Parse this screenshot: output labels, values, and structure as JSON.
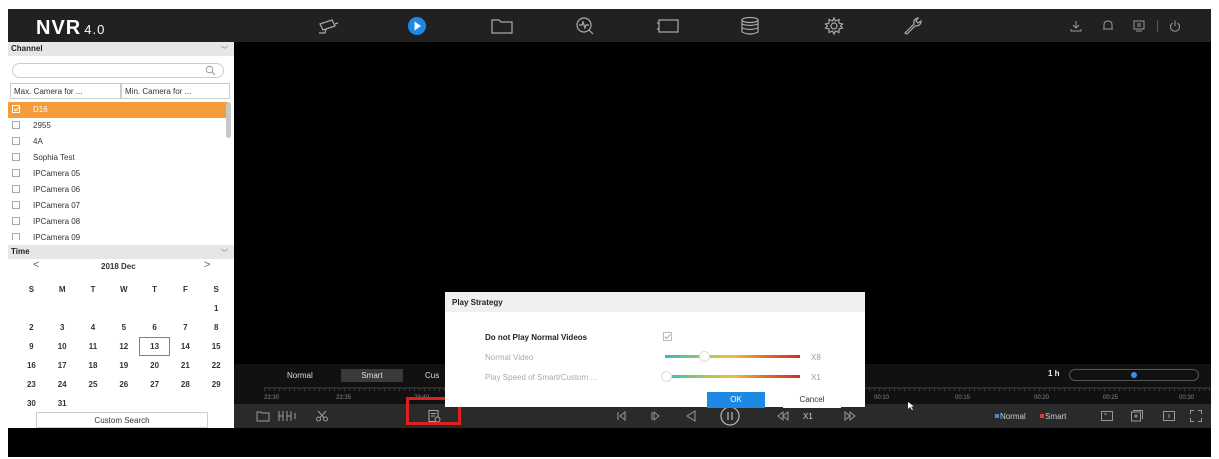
{
  "app": {
    "logo": "NVR",
    "version": "4.0"
  },
  "channel": {
    "title": "Channel",
    "search_placeholder": "",
    "max_camera_label": "Max. Camera for ...",
    "min_camera_label": "Min. Camera for ...",
    "items": [
      {
        "label": "D16",
        "selected": true
      },
      {
        "label": "2955",
        "selected": false
      },
      {
        "label": "4A",
        "selected": false
      },
      {
        "label": "Sophia Test",
        "selected": false
      },
      {
        "label": "IPCamera 05",
        "selected": false
      },
      {
        "label": "IPCamera 06",
        "selected": false
      },
      {
        "label": "IPCamera 07",
        "selected": false
      },
      {
        "label": "IPCamera 08",
        "selected": false
      },
      {
        "label": "IPCamera 09",
        "selected": false
      }
    ]
  },
  "time": {
    "title": "Time",
    "month_label": "2018 Dec",
    "weekdays": [
      "S",
      "M",
      "T",
      "W",
      "T",
      "F",
      "S"
    ],
    "weeks": [
      [
        "",
        "",
        "",
        "",
        "",
        "",
        "1"
      ],
      [
        "2",
        "3",
        "4",
        "5",
        "6",
        "7",
        "8"
      ],
      [
        "9",
        "10",
        "11",
        "12",
        "13",
        "14",
        "15"
      ],
      [
        "16",
        "17",
        "18",
        "19",
        "20",
        "21",
        "22"
      ],
      [
        "23",
        "24",
        "25",
        "26",
        "27",
        "28",
        "29"
      ],
      [
        "30",
        "31",
        "",
        "",
        "",
        "",
        ""
      ]
    ],
    "today": "13",
    "custom_search_label": "Custom Search"
  },
  "timeline": {
    "tabs": [
      "Normal",
      "Smart",
      "Cus"
    ],
    "active_tab": "Smart",
    "scale_label": "1 h",
    "scale_value": 0.5,
    "ticks": [
      "23:30",
      "23:35",
      "23:40",
      "00:10",
      "00:15",
      "00:20",
      "00:25",
      "00:30"
    ],
    "speed_label": "X1",
    "legend": {
      "normal": "Normal",
      "smart": "Smart",
      "normal_color": "#3a8ee6",
      "smart_color": "#e53935"
    }
  },
  "dialog": {
    "title": "Play Strategy",
    "opt_do_not_play": "Do not Play Normal Videos",
    "opt_normal_video": "Normal Video",
    "opt_smart_speed": "Play Speed of Smart/Custom ...",
    "normal_video_speed": "X8",
    "smart_speed": "X1",
    "ok": "OK",
    "cancel": "Cancel"
  },
  "colors": {
    "accent": "#1e88e5",
    "selection": "#f39c3b",
    "highlight": "#e02020"
  }
}
